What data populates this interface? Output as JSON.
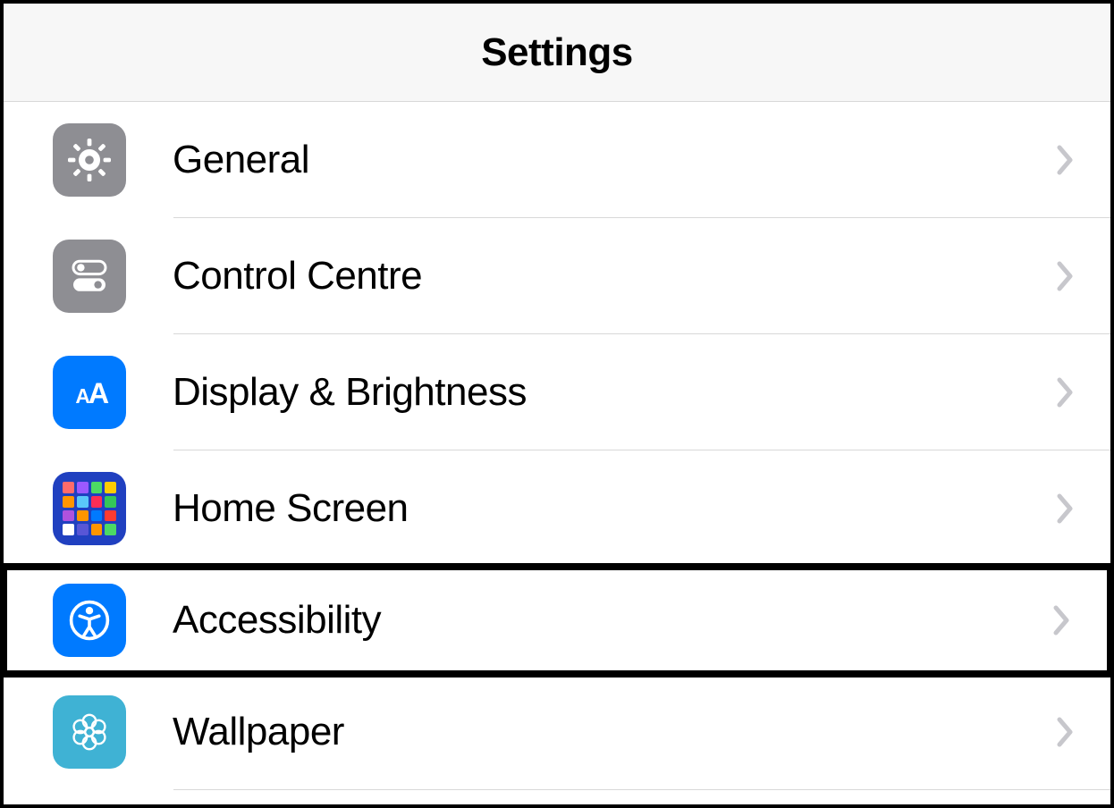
{
  "header": {
    "title": "Settings"
  },
  "rows": [
    {
      "id": "general",
      "label": "General",
      "icon": "gear-icon",
      "highlighted": false
    },
    {
      "id": "control-centre",
      "label": "Control Centre",
      "icon": "toggles-icon",
      "highlighted": false
    },
    {
      "id": "display",
      "label": "Display & Brightness",
      "icon": "text-size-icon",
      "highlighted": false
    },
    {
      "id": "home-screen",
      "label": "Home Screen",
      "icon": "app-grid-icon",
      "highlighted": false
    },
    {
      "id": "accessibility",
      "label": "Accessibility",
      "icon": "accessibility-icon",
      "highlighted": true
    },
    {
      "id": "wallpaper",
      "label": "Wallpaper",
      "icon": "flower-icon",
      "highlighted": false
    }
  ]
}
